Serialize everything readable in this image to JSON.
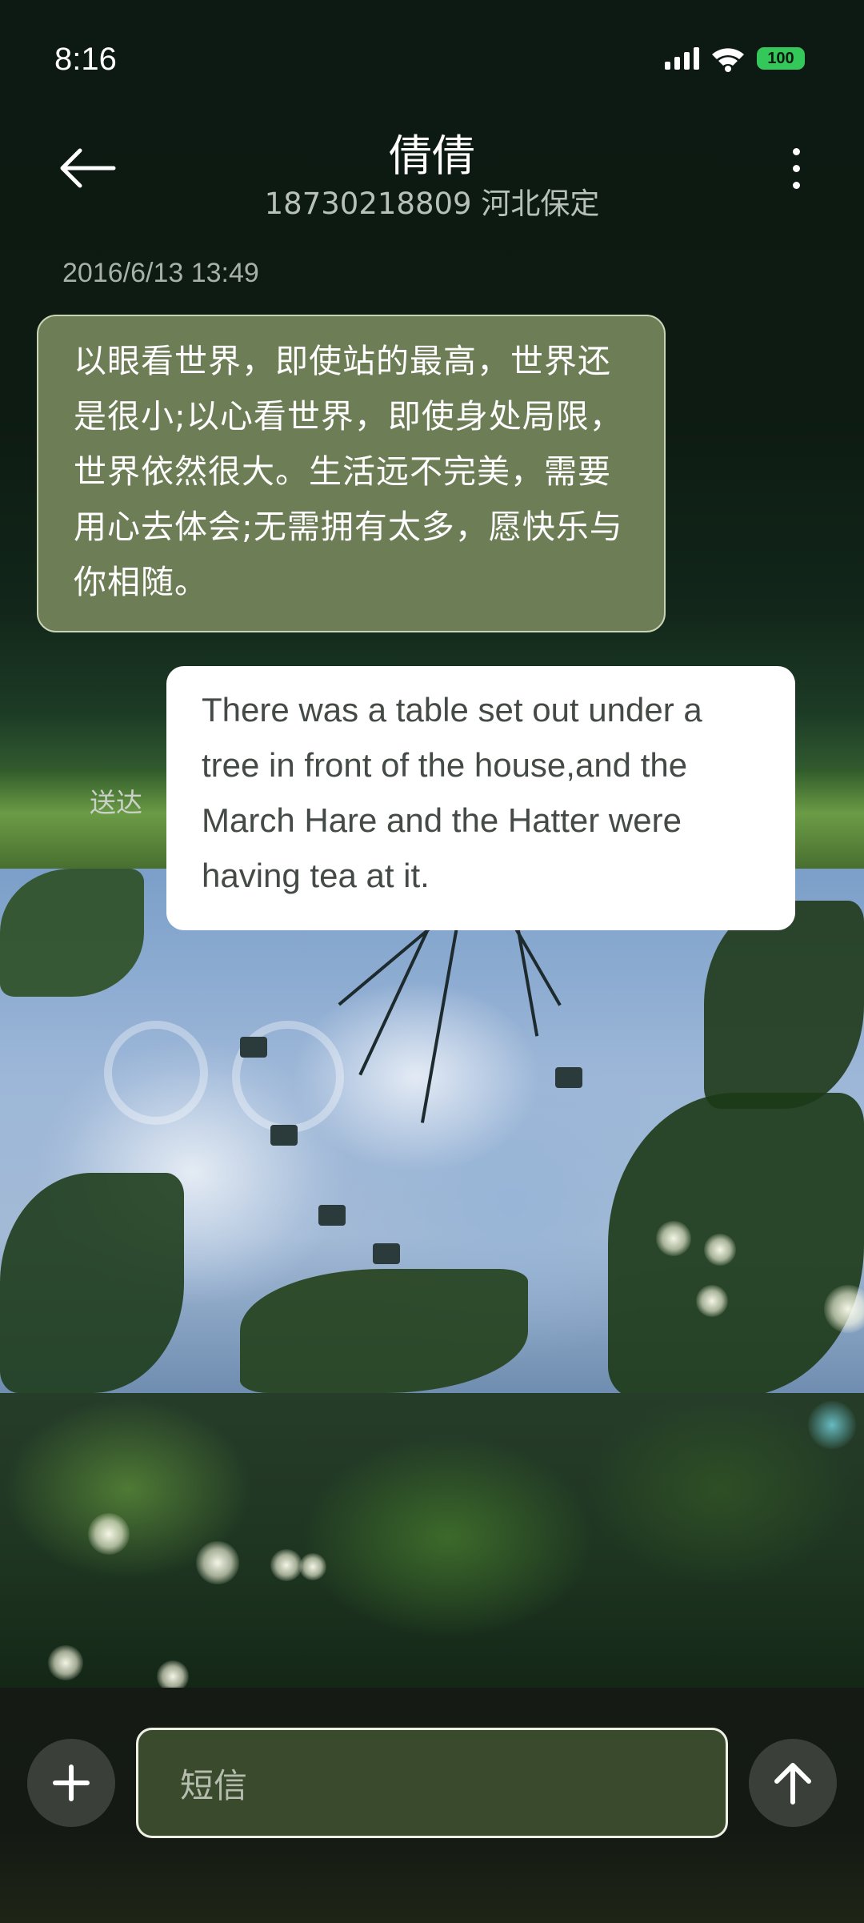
{
  "status_bar": {
    "time": "8:16",
    "battery": "100",
    "battery_color": "#34c759"
  },
  "header": {
    "contact_name": "倩倩",
    "contact_sub": "18730218809 河北保定",
    "back_icon": "arrow-left-icon",
    "more_icon": "more-vertical-icon"
  },
  "conversation": {
    "timestamp": "2016/6/13 13:49",
    "messages": [
      {
        "direction": "incoming",
        "text": "以眼看世界，即使站的最高，世界还是很小;以心看世界，即使身处局限，世界依然很大。生活远不完美，需要用心去体会;无需拥有太多，愿快乐与你相随。",
        "bubble_color": "#6d7d55"
      },
      {
        "direction": "outgoing",
        "text": "There was a table set out under a tree in front of the house,and the March Hare and the Hatter were having tea at it.",
        "status": "送达",
        "bubble_color": "#ffffff"
      }
    ]
  },
  "composer": {
    "placeholder": "短信",
    "add_icon": "plus-icon",
    "send_icon": "arrow-up-icon"
  }
}
